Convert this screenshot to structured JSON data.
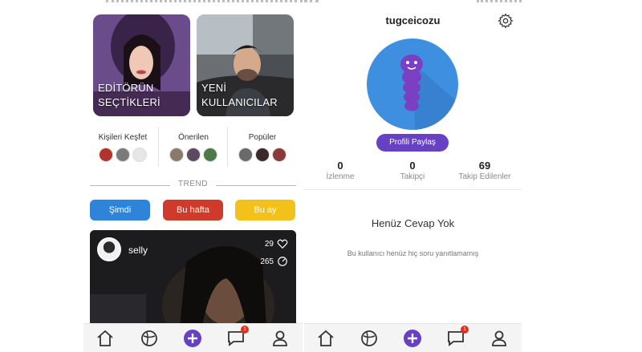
{
  "left_screen": {
    "cards": [
      {
        "title": "EDİTÖRÜN\nSEÇTİKLERİ"
      },
      {
        "title": "YENİ\nKULLANICILAR"
      }
    ],
    "categories": [
      {
        "label": "Kişileri Keşfet"
      },
      {
        "label": "Önerilen"
      },
      {
        "label": "Popüler"
      }
    ],
    "trend_label": "TREND",
    "filters": [
      {
        "label": "Şimdi",
        "color": "#2f83d8"
      },
      {
        "label": "Bu hafta",
        "color": "#cf3a2a"
      },
      {
        "label": "Bu ay",
        "color": "#f2c21a"
      }
    ],
    "post": {
      "username": "selly",
      "likes": "29",
      "views": "265"
    },
    "tabs": {
      "messages_badge": "1"
    }
  },
  "right_screen": {
    "username": "tugceicozu",
    "share_button": "Profili Paylaş",
    "stats": [
      {
        "value": "0",
        "label": "İzlenme"
      },
      {
        "value": "0",
        "label": "Takipçi"
      },
      {
        "value": "69",
        "label": "Takip Edilenler"
      }
    ],
    "empty_title": "Henüz Cevap Yok",
    "empty_subtitle": "Bu kullanıcı henüz hiç soru yanıtlamamış",
    "tabs": {
      "messages_badge": "1"
    }
  },
  "colors": {
    "accent_purple": "#6840c3",
    "avatar_blue": "#3f8fe0"
  }
}
